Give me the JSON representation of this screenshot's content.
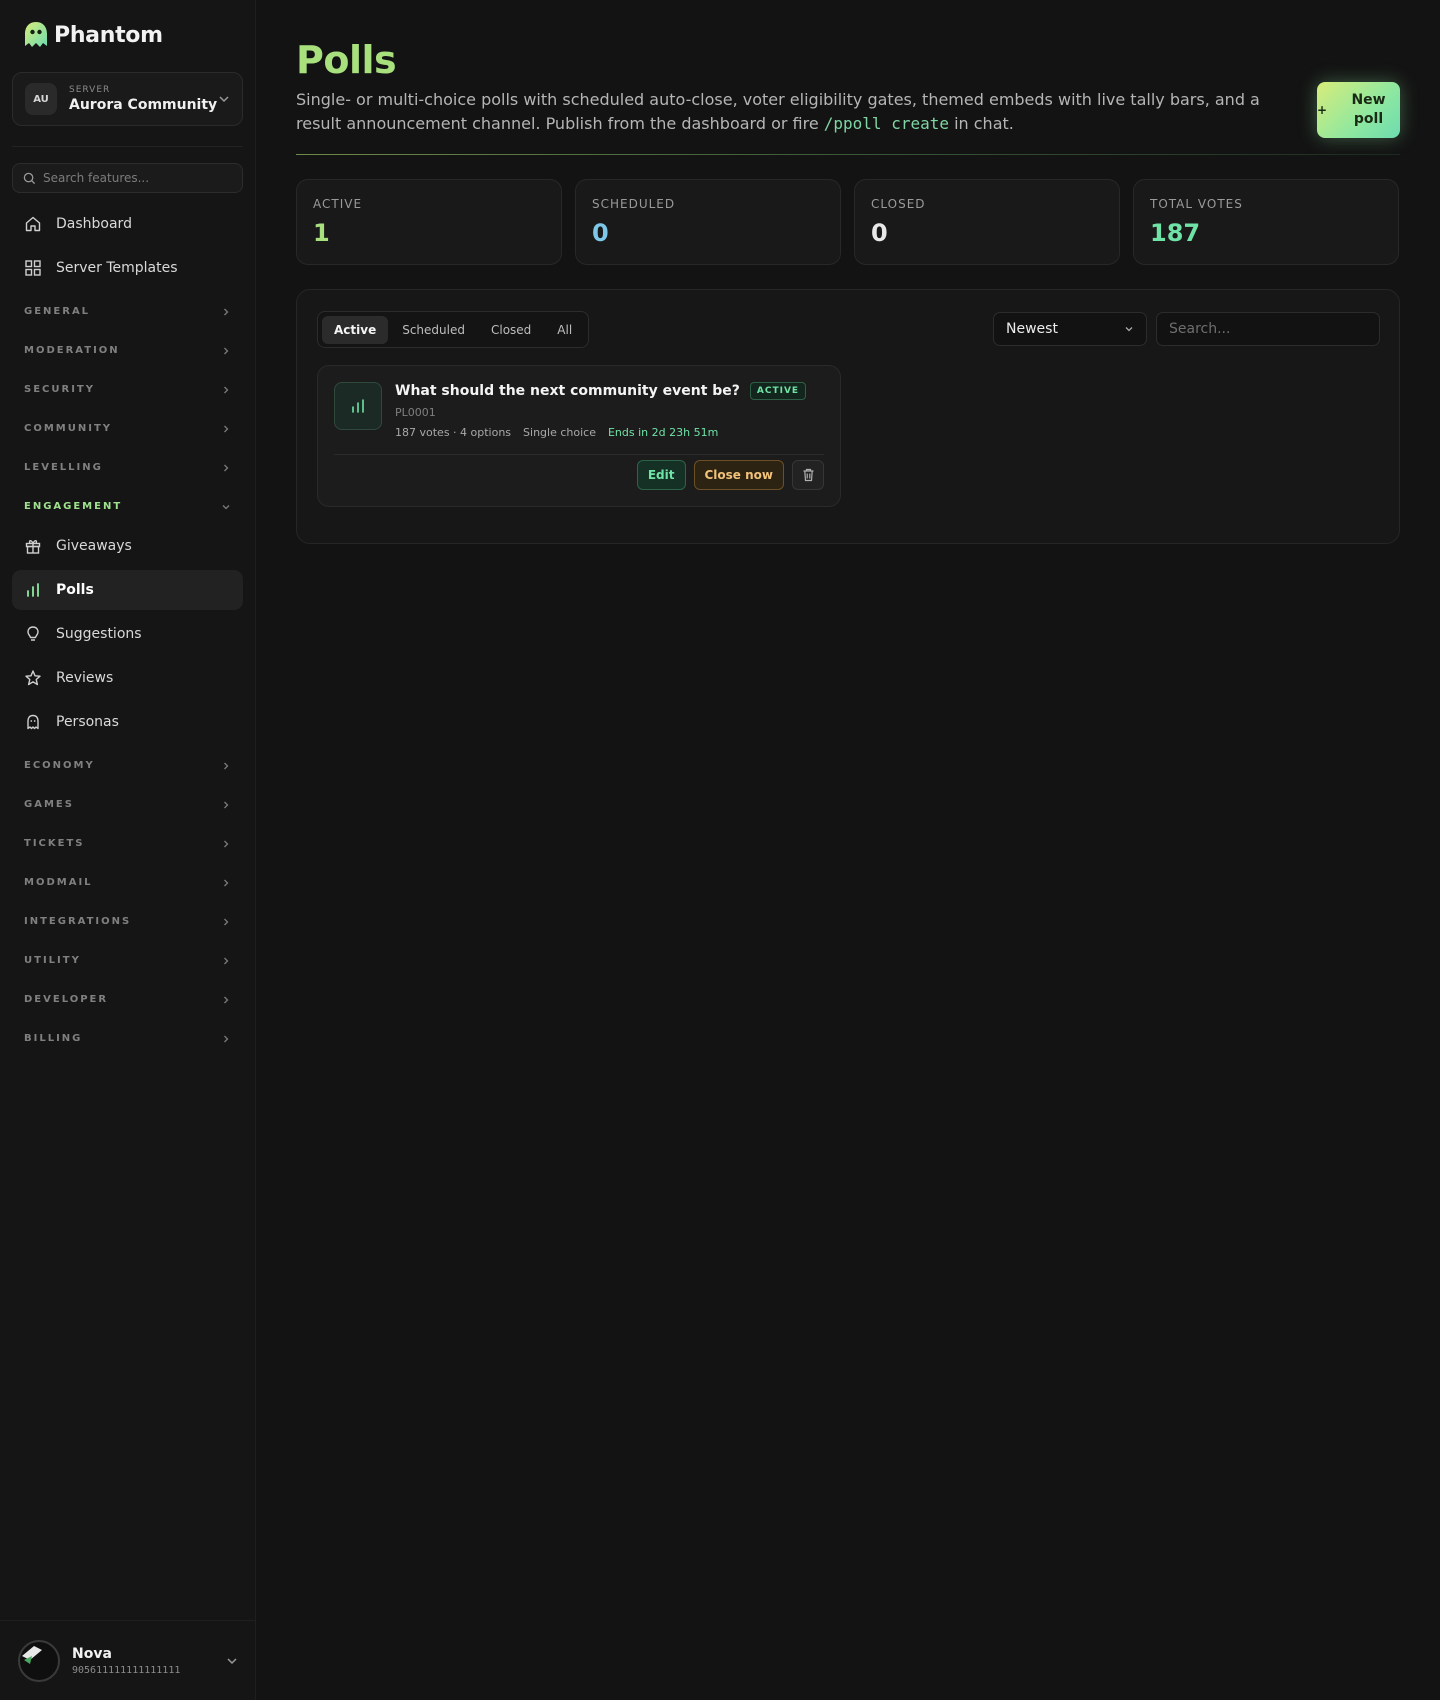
{
  "brand": {
    "name": "Phantom"
  },
  "server": {
    "label": "SERVER",
    "initials": "AU",
    "name": "Aurora Community"
  },
  "sidebar": {
    "search_placeholder": "Search features...",
    "top_items": [
      {
        "label": "Dashboard",
        "icon": "home-icon"
      },
      {
        "label": "Server Templates",
        "icon": "grid-icon"
      }
    ],
    "sections_before": [
      "GENERAL",
      "MODERATION",
      "SECURITY",
      "COMMUNITY",
      "LEVELLING"
    ],
    "open_section": "ENGAGEMENT",
    "engagement_items": [
      {
        "label": "Giveaways",
        "icon": "gift-icon"
      },
      {
        "label": "Polls",
        "icon": "bar-chart-icon",
        "active": true
      },
      {
        "label": "Suggestions",
        "icon": "lightbulb-icon"
      },
      {
        "label": "Reviews",
        "icon": "star-icon"
      },
      {
        "label": "Personas",
        "icon": "ghost-icon"
      }
    ],
    "sections_after": [
      "ECONOMY",
      "GAMES",
      "TICKETS",
      "MODMAIL",
      "INTEGRATIONS",
      "UTILITY",
      "DEVELOPER",
      "BILLING"
    ]
  },
  "user": {
    "name": "Nova",
    "id": "905611111111111111"
  },
  "page": {
    "title": "Polls",
    "description_before": "Single- or multi-choice polls with scheduled auto-close, voter eligibility gates, themed embeds with live tally bars, and a result announcement channel. Publish from the dashboard or fire ",
    "description_code": "/ppoll create",
    "description_after": " in chat.",
    "new_button_plus": "+",
    "new_button_label": "New poll"
  },
  "stats": [
    {
      "label": "ACTIVE",
      "value": "1",
      "color": "#a8e07e"
    },
    {
      "label": "SCHEDULED",
      "value": "0",
      "color": "#7dc8e8"
    },
    {
      "label": "CLOSED",
      "value": "0",
      "color": "#e8e8e8"
    },
    {
      "label": "TOTAL VOTES",
      "value": "187",
      "color": "#6fe3a6"
    }
  ],
  "filters": {
    "tabs": [
      "Active",
      "Scheduled",
      "Closed",
      "All"
    ],
    "active_tab": "Active",
    "sort_value": "Newest",
    "search_placeholder": "Search..."
  },
  "polls": [
    {
      "title": "What should the next community event be?",
      "status": "ACTIVE",
      "id": "PL0001",
      "votes_options": "187 votes · 4 options",
      "mode": "Single choice",
      "ends": "Ends in 2d 23h 51m",
      "edit_label": "Edit",
      "close_label": "Close now"
    }
  ]
}
